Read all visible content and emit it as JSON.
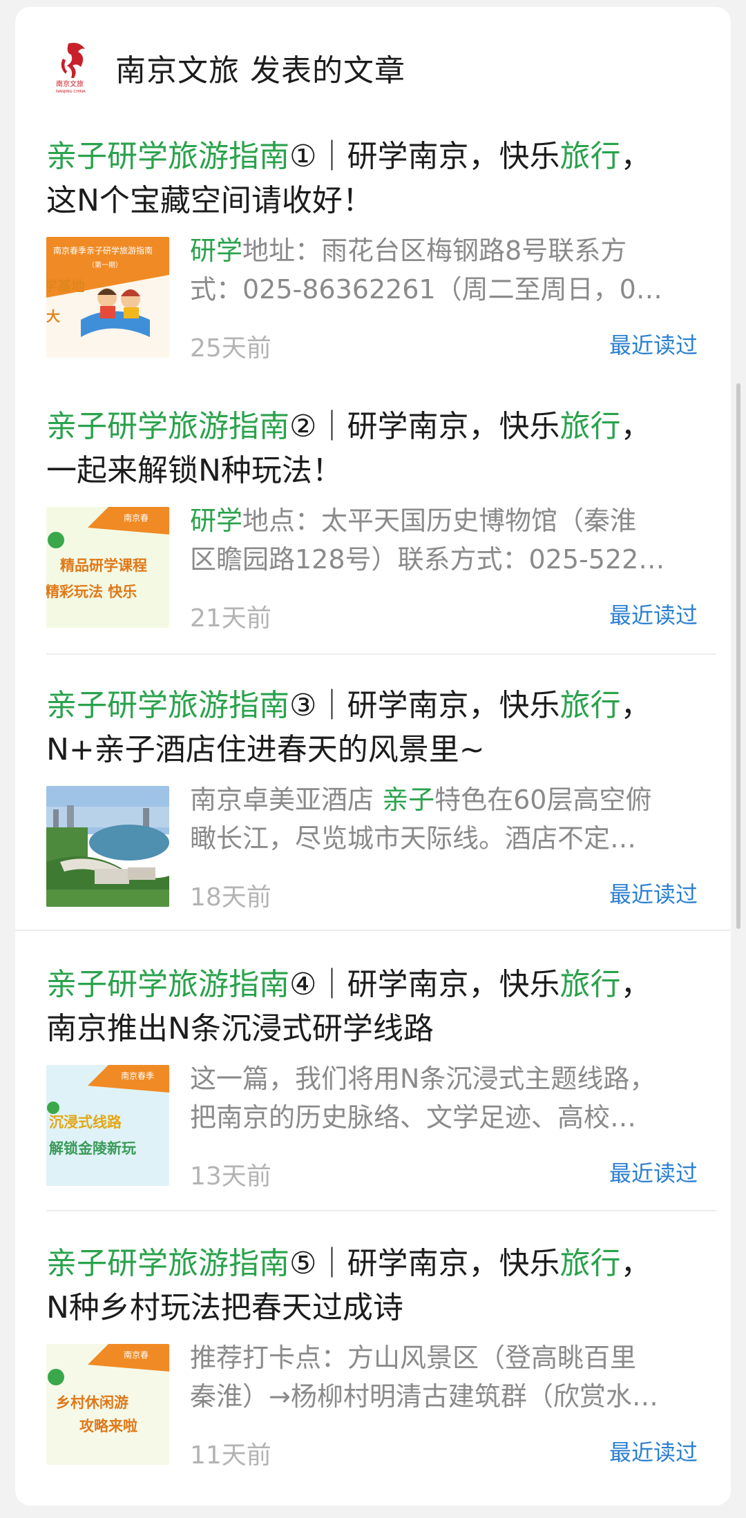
{
  "header": {
    "account": "南京文旅",
    "suffix": "发表的文章",
    "logo_icon": "nanjing-culture-tourism-logo"
  },
  "colors": {
    "highlight": "#2aa24c",
    "recent": "#2b7fd0",
    "meta": "#b3b3b3"
  },
  "articles": [
    {
      "title_hl1": "亲子研学旅游指南",
      "title_mid": "①｜研学南京，快乐",
      "title_hl2": "旅行",
      "title_end": "，",
      "title_line2": "这N个宝藏空间请收好！",
      "snippet_hl": "研学",
      "snippet_line1": "地址：雨花台区梅钢路8号联系方",
      "snippet_line2": "式：025-86362261（周二至周日，0…",
      "age": "25天前",
      "recent": "最近读过",
      "thumb_text": [
        "南京春季亲子研学旅游指南",
        "（第一期）",
        "学基地",
        "大"
      ]
    },
    {
      "title_hl1": "亲子研学旅游指南",
      "title_mid": "②｜研学南京，快乐",
      "title_hl2": "旅行",
      "title_end": "，",
      "title_line2": "一起来解锁N种玩法！",
      "snippet_hl": "研学",
      "snippet_line1": "地点：太平天国历史博物馆（秦淮",
      "snippet_line2": "区瞻园路128号）联系方式：025-522…",
      "age": "21天前",
      "recent": "最近读过",
      "thumb_text": [
        "南京春",
        "精品研学课程",
        "精彩玩法 快乐"
      ]
    },
    {
      "title_hl1": "亲子研学旅游指南",
      "title_mid": "③｜研学南京，快乐",
      "title_hl2": "旅行",
      "title_end": "，",
      "title_line2": "N+亲子酒店住进春天的风景里~",
      "snippet_pre": "南京卓美亚酒店 ",
      "snippet_hl": "亲子",
      "snippet_line1": "特色在60层高空俯",
      "snippet_line2": "瞰长江，尽览城市天际线。酒店不定…",
      "age": "18天前",
      "recent": "最近读过"
    },
    {
      "title_hl1": "亲子研学旅游指南",
      "title_mid": "④｜研学南京，快乐",
      "title_hl2": "旅行",
      "title_end": "，",
      "title_line2": "南京推出N条沉浸式研学线路",
      "snippet_line1": "这一篇，我们将用N条沉浸式主题线路，",
      "snippet_line2": "把南京的历史脉络、文学足迹、高校…",
      "age": "13天前",
      "recent": "最近读过",
      "thumb_text": [
        "南京春季",
        "沉浸式线路",
        "解锁金陵新玩"
      ]
    },
    {
      "title_hl1": "亲子研学旅游指南",
      "title_mid": "⑤｜研学南京，快乐",
      "title_hl2": "旅行",
      "title_end": "，",
      "title_line2": "N种乡村玩法把春天过成诗",
      "snippet_line1": "推荐打卡点：方山风景区（登高眺百里",
      "snippet_line2": "秦淮）→杨柳村明清古建筑群（欣赏水…",
      "age": "11天前",
      "recent": "最近读过",
      "thumb_text": [
        "南京春",
        "乡村休闲游",
        "攻略来啦"
      ]
    }
  ]
}
